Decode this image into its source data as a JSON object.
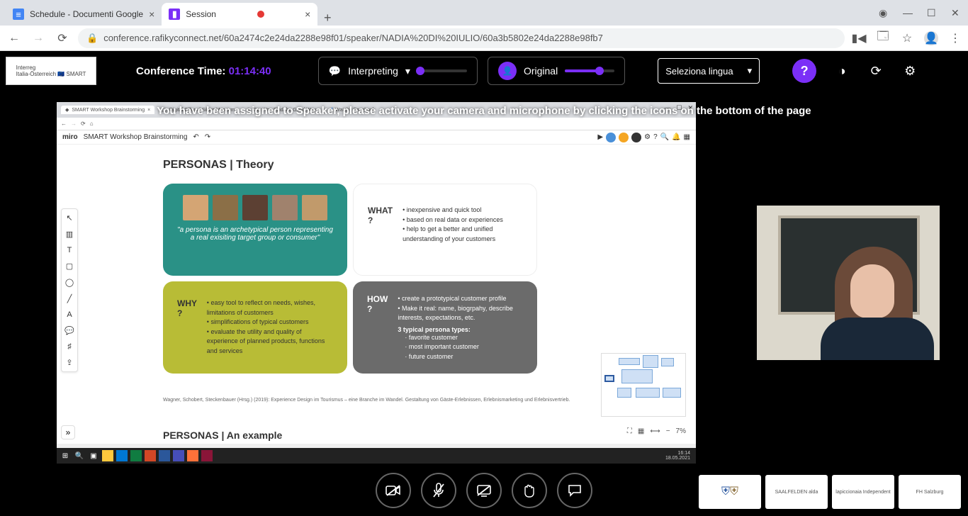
{
  "browser": {
    "tabs": [
      {
        "title": "Schedule - Documenti Google",
        "favicon_bg": "#4285f4"
      },
      {
        "title": "Session",
        "favicon_bg": "#7b2ff7",
        "recording": true
      }
    ],
    "url": "conference.rafikyconnect.net/60a2474c2e24da2288e98f01/speaker/NADIA%20DI%20IULIO/60a3b5802e24da2288e98fb7"
  },
  "conference": {
    "time_label": "Conference Time:",
    "time_value": "01:14:40",
    "interpreting_label": "Interpreting",
    "original_label": "Original",
    "lang_placeholder": "Seleziona lingua",
    "banner": "You have been assigned to Speaker, please activate your camera and microphone by clicking the icons on the bottom of the page",
    "interp_volume": 0,
    "orig_volume": 70
  },
  "shared": {
    "inner_tabs": [
      "SMART Workshop Brainstorming",
      "Digital Offers | Silber Museum",
      "Can You Find the Good Way...",
      "Watch | Facebook"
    ],
    "miro_logo": "miro",
    "miro_doc": "SMART Workshop Brainstorming",
    "slide_title": "PERSONAS | Theory",
    "teal_quote": "\"a persona is an archetypical person representing a real exisiting target group or consumer\"",
    "what_label": "WHAT ?",
    "what_items": [
      "inexpensive and quick tool",
      "based on real data or experiences",
      "help to get a better and unified understanding of your customers"
    ],
    "why_label": "WHY ?",
    "why_items": [
      "easy tool to reflect on needs, wishes, limitations of customers",
      "simplifications of typical customers",
      "evaluate the utility and quality of experience of planned products, functions and services"
    ],
    "how_label": "HOW ?",
    "how_items": [
      "create a prototypical customer profile",
      "Make it real: name, biogrpahy, describe interests, expectations, etc."
    ],
    "how_types_label": "3 typical persona types:",
    "how_types": [
      "favorite customer",
      "most important customer",
      "future customer"
    ],
    "citation": "Wagner, Schobert, Steckenbauer (Hrsg.) (2019): Experience Design im Tourismus – eine Branche im Wandel. Gestaltung von Gäste-Erlebnissen, Erlebnismarketing und Erlebnisvertrieb.",
    "next_heading": "PERSONAS | An example",
    "zoom": "7%",
    "taskbar_time": "16:14",
    "taskbar_date": "18.05.2021"
  },
  "sponsors": [
    "",
    "SAALFELDEN  alda",
    "lapiccionaia  Independent",
    "FH Salzburg"
  ]
}
